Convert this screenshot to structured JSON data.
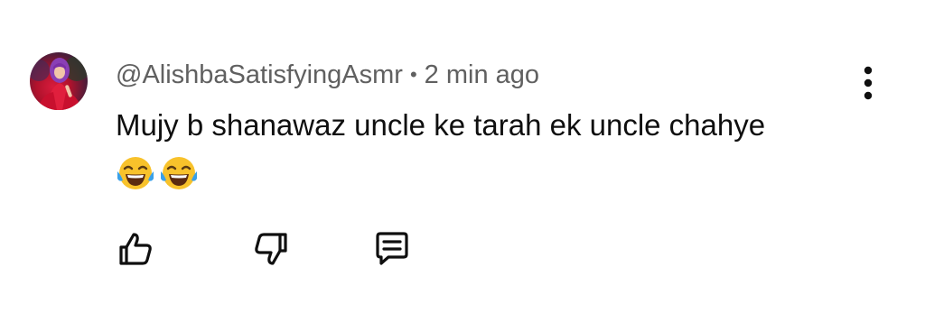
{
  "comment": {
    "author_handle": "@AlishbaSatisfyingAsmr",
    "separator": "•",
    "timestamp": "2 min ago",
    "text": "Mujy b shanawaz uncle ke tarah ek uncle chahye",
    "emojis": [
      "face-with-tears-of-joy",
      "face-with-tears-of-joy"
    ]
  },
  "icons": {
    "menu": "more-vert-icon",
    "like": "thumb-up-icon",
    "dislike": "thumb-down-icon",
    "reply": "reply-comment-icon"
  },
  "colors": {
    "text_primary": "#0f0f0f",
    "text_secondary": "#606060",
    "emoji_face": "#f8c22b",
    "emoji_tears": "#3aa0e8"
  }
}
